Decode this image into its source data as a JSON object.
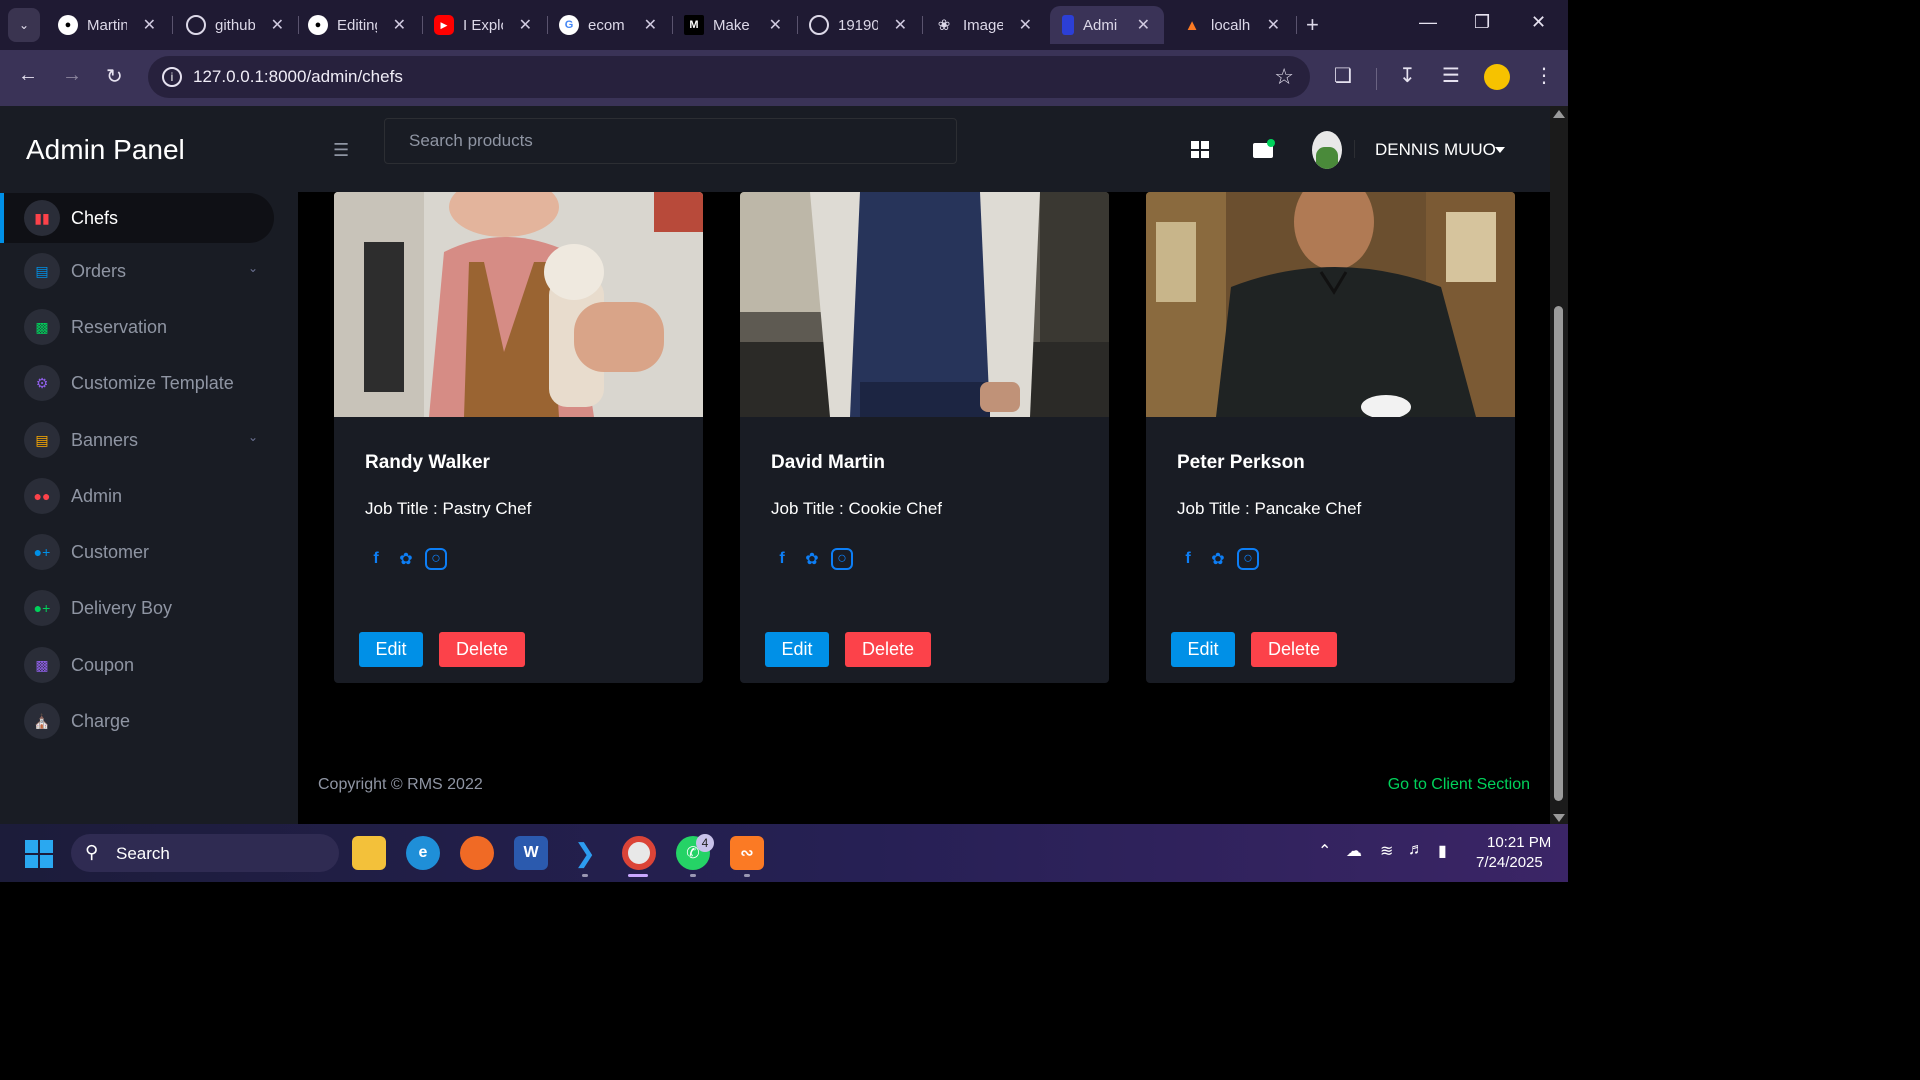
{
  "browser": {
    "tabs": [
      {
        "title": "Martin",
        "icon": "github-icon"
      },
      {
        "title": "github",
        "icon": "globe-icon"
      },
      {
        "title": "Editing",
        "icon": "github-icon"
      },
      {
        "title": "I Explo",
        "icon": "youtube-icon"
      },
      {
        "title": "ecom",
        "icon": "google-icon"
      },
      {
        "title": "Make",
        "icon": "medium-icon"
      },
      {
        "title": "19190",
        "icon": "globe-icon"
      },
      {
        "title": "Image",
        "icon": "openai-icon"
      },
      {
        "title": "Admi",
        "icon": "admin-tab-icon",
        "active": true
      },
      {
        "title": "localh",
        "icon": "xampp-icon"
      }
    ],
    "url": "127.0.0.1:8000/admin/chefs"
  },
  "sidebar": {
    "brand": "Admin Panel",
    "items": [
      {
        "label": "Chefs",
        "icon": "chef-icon",
        "color": "#fc424a",
        "active": true
      },
      {
        "label": "Orders",
        "icon": "orders-icon",
        "color": "#0090e7",
        "has_children": true
      },
      {
        "label": "Reservation",
        "icon": "chart-icon",
        "color": "#00d25b"
      },
      {
        "label": "Customize Template",
        "icon": "gear-icon",
        "color": "#8f5fe8"
      },
      {
        "label": "Banners",
        "icon": "banner-icon",
        "color": "#ffab00",
        "has_children": true
      },
      {
        "label": "Admin",
        "icon": "users-icon",
        "color": "#fc424a"
      },
      {
        "label": "Customer",
        "icon": "add-user-icon",
        "color": "#0090e7"
      },
      {
        "label": "Delivery Boy",
        "icon": "add-user-icon",
        "color": "#00d25b"
      },
      {
        "label": "Coupon",
        "icon": "coupon-icon",
        "color": "#8f5fe8"
      },
      {
        "label": "Charge",
        "icon": "bank-icon",
        "color": "#ffab00"
      }
    ]
  },
  "topnav": {
    "search_placeholder": "Search products",
    "username": "DENNIS MUUO"
  },
  "chefs": [
    {
      "name": "Randy Walker",
      "job": "Job Title : Pastry Chef"
    },
    {
      "name": "David Martin",
      "job": "Job Title : Cookie Chef"
    },
    {
      "name": "Peter Perkson",
      "job": "Job Title : Pancake Chef"
    }
  ],
  "buttons": {
    "edit": "Edit",
    "delete": "Delete"
  },
  "footer": {
    "copyright": "Copyright © RMS 2022",
    "client_link": "Go to Client Section"
  },
  "taskbar": {
    "search_label": "Search",
    "whatsapp_badge": "4",
    "time": "10:21 PM",
    "date": "7/24/2025"
  },
  "colors": {
    "accent": "#0090e7",
    "danger": "#fc424a",
    "success": "#00d25b"
  }
}
